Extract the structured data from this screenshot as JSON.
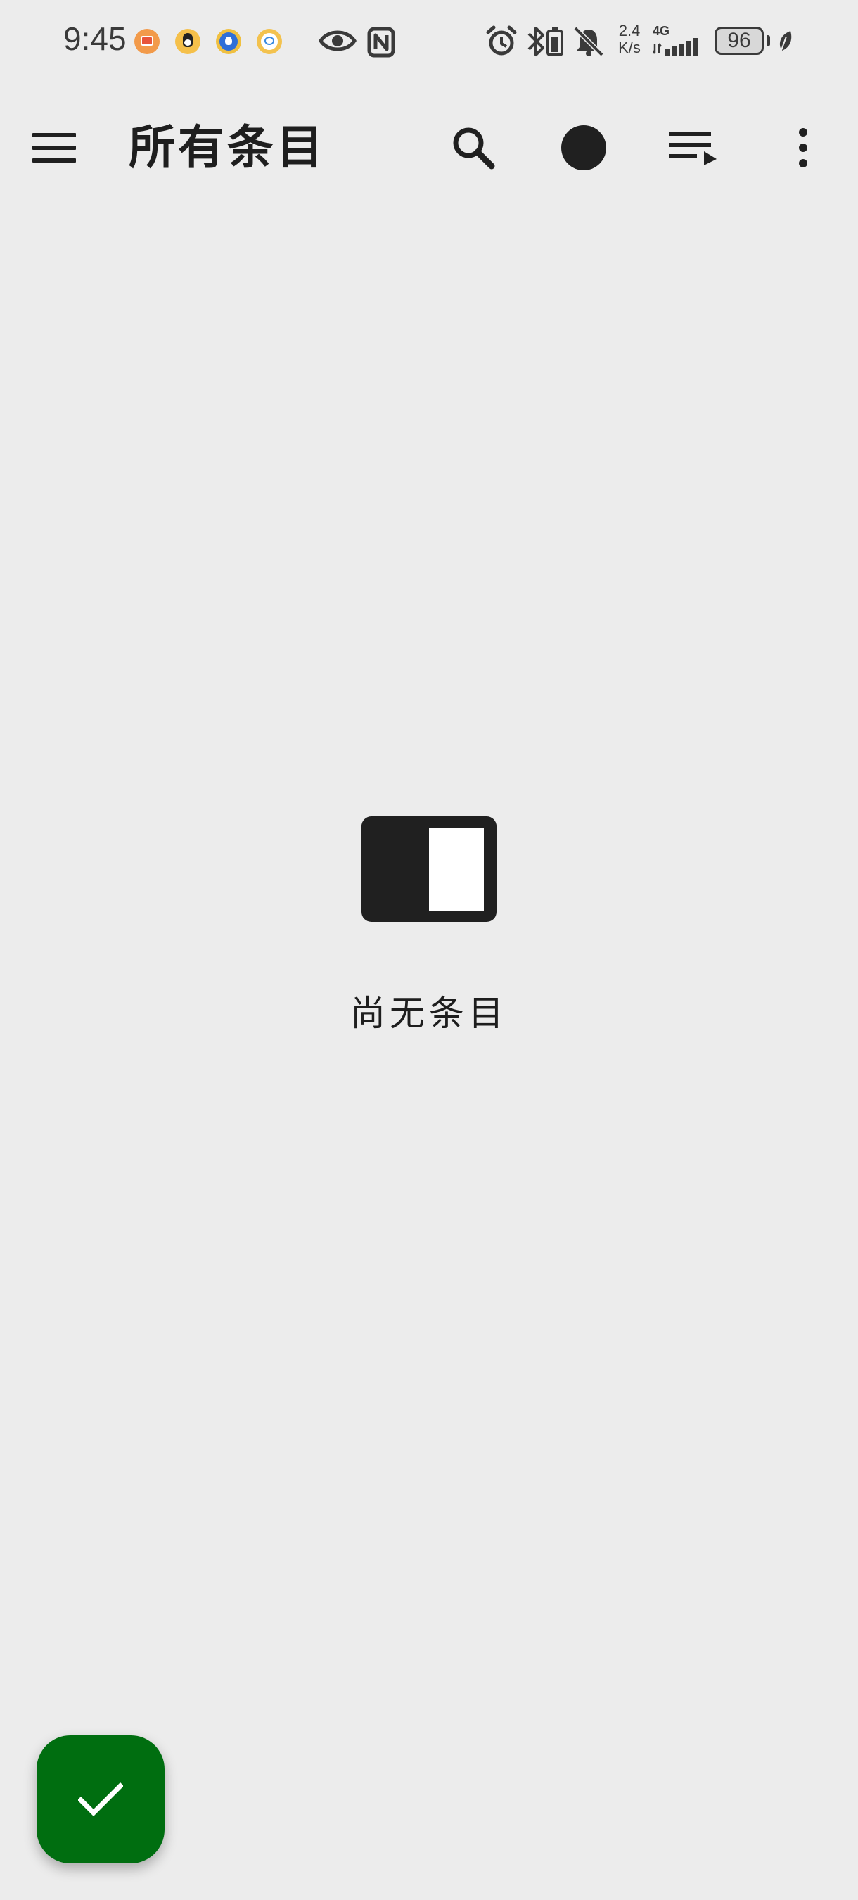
{
  "status_bar": {
    "time": "9:45",
    "net_speed_value": "2.4",
    "net_speed_unit": "K/s",
    "net_type": "4G",
    "battery": "96",
    "notification_icons": [
      "video-app-icon",
      "qq-icon",
      "blue-app-icon",
      "chat-bubble-icon"
    ],
    "system_icons": [
      "eye-icon",
      "nfc-icon",
      "alarm-icon",
      "bluetooth-battery-icon",
      "bell-off-icon",
      "signal-icon",
      "leaf-icon"
    ]
  },
  "app_bar": {
    "title": "所有条目",
    "actions": [
      "search-icon",
      "circle-icon",
      "playlist-play-icon",
      "more-vert-icon"
    ]
  },
  "empty_state": {
    "message": "尚无条目",
    "icon": "split-view-icon"
  },
  "fab": {
    "icon": "check-icon"
  },
  "colors": {
    "background": "#ececec",
    "fab": "#006e10",
    "icon": "#202020"
  }
}
